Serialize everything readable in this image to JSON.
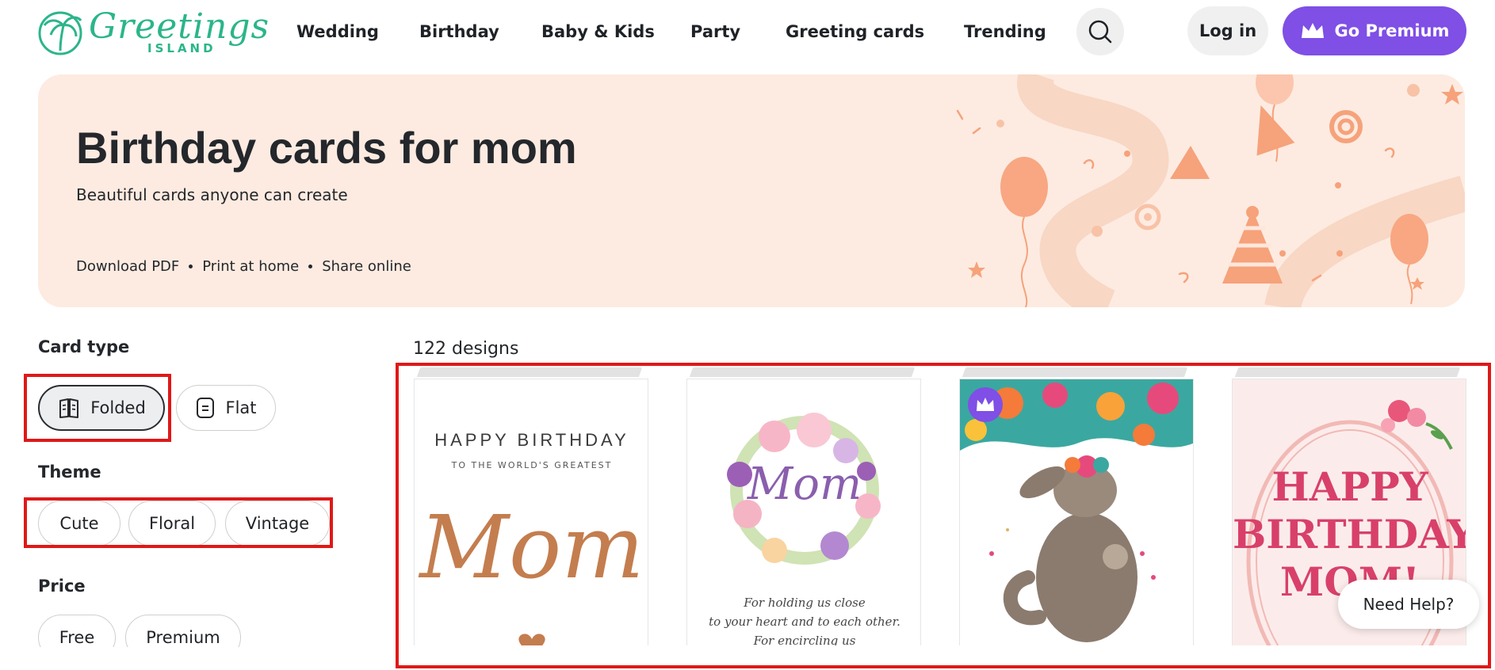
{
  "brand": {
    "logo_text": "Greetings",
    "logo_subtext": "ISLAND",
    "color": "#2bb58a"
  },
  "nav": {
    "items": [
      {
        "label": "Wedding"
      },
      {
        "label": "Birthday"
      },
      {
        "label": "Baby & Kids"
      },
      {
        "label": "Party"
      },
      {
        "label": "Greeting cards"
      },
      {
        "label": "Trending"
      }
    ],
    "search_icon": "search-icon",
    "login_label": "Log in",
    "premium_label": "Go Premium",
    "premium_color": "#7f4fe6"
  },
  "hero": {
    "title": "Birthday cards for mom",
    "subtitle": "Beautiful cards anyone can create",
    "features": [
      "Download PDF",
      "Print at home",
      "Share online"
    ],
    "background": "#fdebe1"
  },
  "filters": {
    "card_type": {
      "heading": "Card type",
      "options": [
        {
          "label": "Folded",
          "icon": "open-book-icon",
          "selected": true
        },
        {
          "label": "Flat",
          "icon": "flat-card-icon",
          "selected": false
        }
      ]
    },
    "theme": {
      "heading": "Theme",
      "options": [
        "Cute",
        "Floral",
        "Vintage"
      ]
    },
    "price": {
      "heading": "Price",
      "options": [
        "Free",
        "Premium"
      ]
    }
  },
  "results": {
    "count_label": "122 designs",
    "cards": [
      {
        "line1": "HAPPY BIRTHDAY",
        "line2": "TO THE WORLD'S GREATEST",
        "script": "Mom",
        "premium": false
      },
      {
        "script": "Mom",
        "verse": [
          "For holding us close",
          "to your heart and to each other.",
          "For encircling us"
        ],
        "premium": false
      },
      {
        "premium": true,
        "badge_icon": "crown-icon"
      },
      {
        "headline": [
          "HAPPY",
          "BIRTHDAY,",
          "MOM!"
        ],
        "premium": false
      }
    ]
  },
  "help": {
    "label": "Need Help?"
  }
}
